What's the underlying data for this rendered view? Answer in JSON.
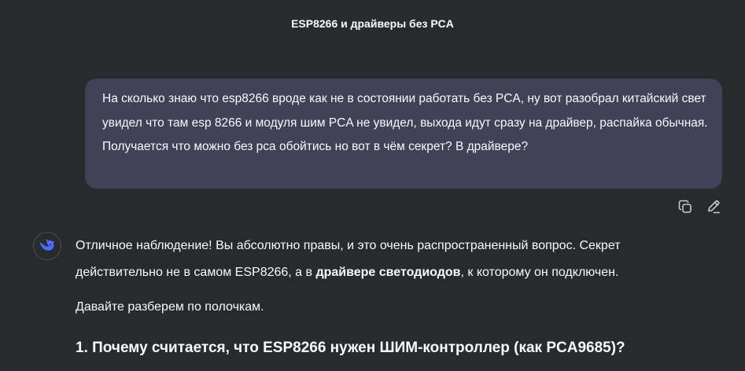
{
  "conversation": {
    "title": "ESP8266 и драйверы без PCA"
  },
  "user_message": {
    "text": "На сколько знаю что esp8266 вроде как не в состоянии работать без PCA, ну вот разобрал китайский свет увидел что там esp 8266 и модуля шим PCA не увидел, выхода идут сразу на драйвер, распайка обычная. Получается что можно без pca обойтись но вот в чём секрет? В драйвере?"
  },
  "message_actions": {
    "copy_icon": "copy-icon",
    "edit_icon": "edit-icon"
  },
  "assistant": {
    "avatar_icon": "deepseek-whale-icon",
    "paragraph1": {
      "before": "Отличное наблюдение! Вы абсолютно правы, и это очень распространенный вопрос. Секрет действительно не в самом ESP8266, а в ",
      "bold": "драйвере светодиодов",
      "after": ", к которому он подключен."
    },
    "paragraph2": "Давайте разберем по полочкам.",
    "heading": "1. Почему считается, что ESP8266 нужен ШИМ-контроллер (как PCA9685)?"
  },
  "colors": {
    "background": "#292a2d",
    "user_bubble": "#414158",
    "text": "#f8faff",
    "accent": "#4d6bfe",
    "icon": "#c9cad1"
  }
}
